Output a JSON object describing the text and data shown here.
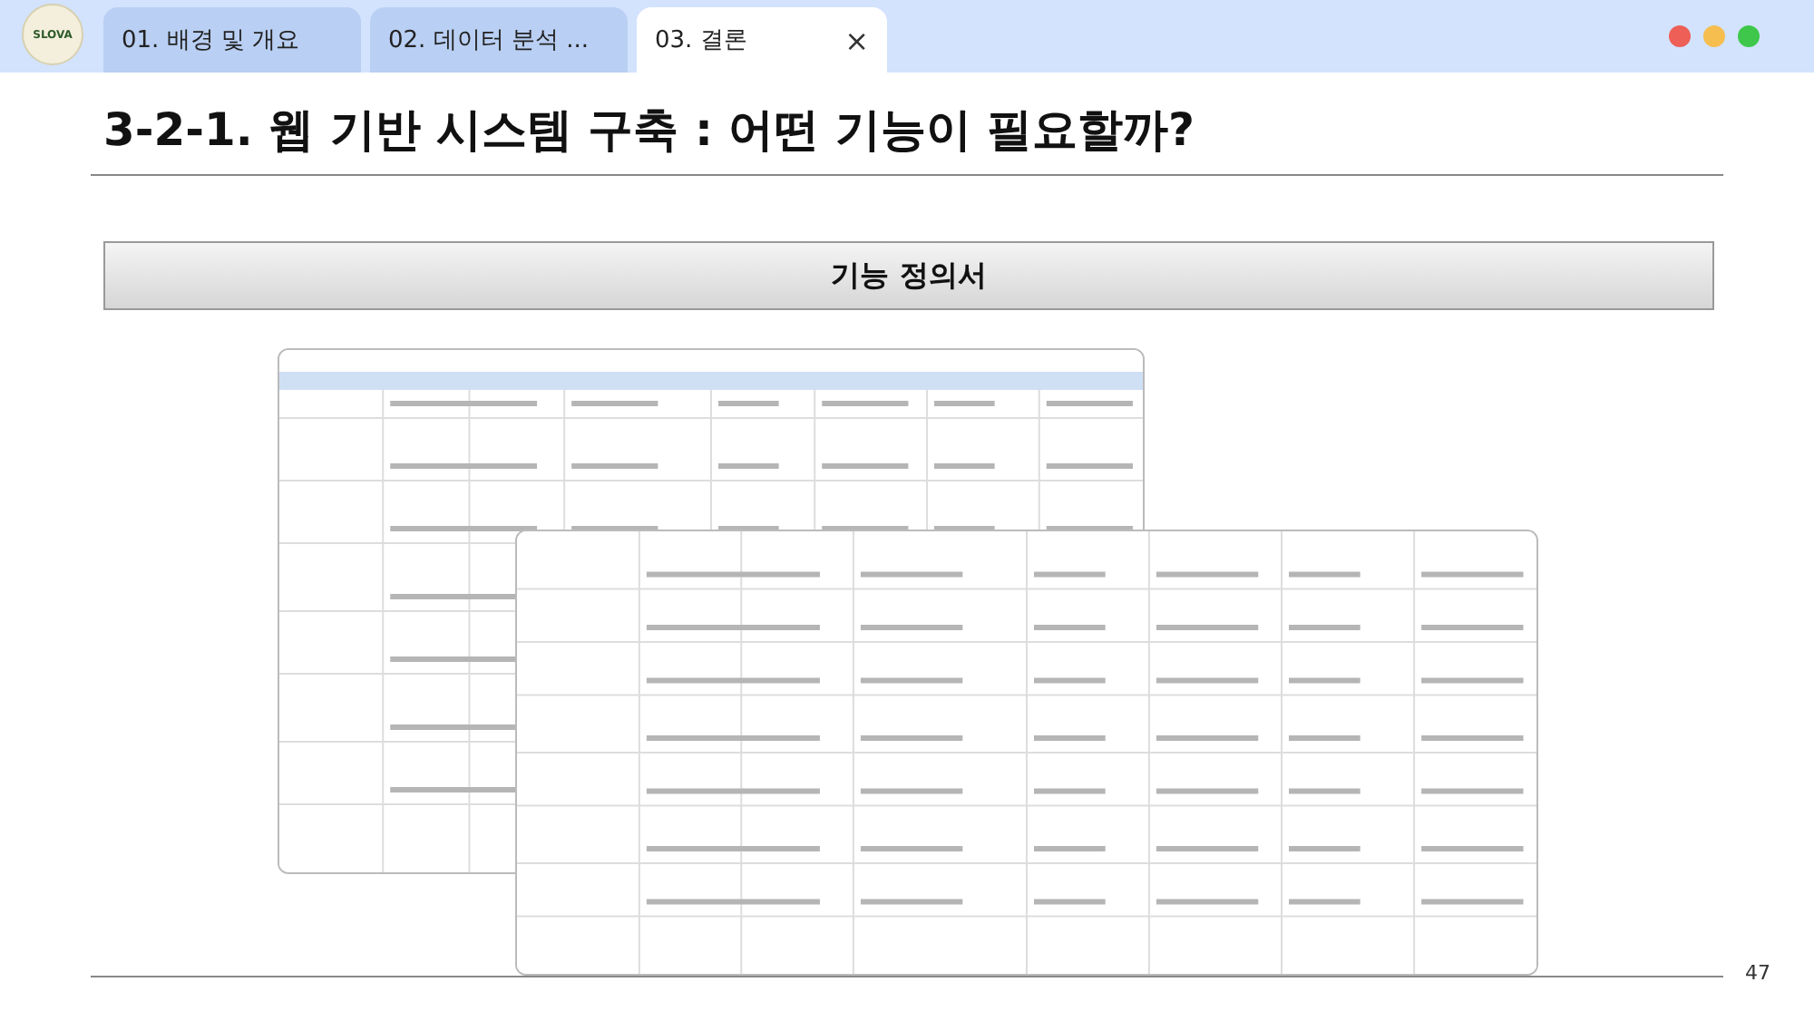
{
  "app": {
    "logo": "SLOVA"
  },
  "tabs": [
    {
      "label": "01. 배경 및 개요",
      "selected": false
    },
    {
      "label": "02. 데이터 분석 ...",
      "selected": false
    },
    {
      "label": "03. 결론",
      "selected": true,
      "close": "×"
    }
  ],
  "slide": {
    "title": "3-2-1. 웹 기반 시스템 구축 : 어떤 기능이 필요할까?",
    "banner": "기능 정의서",
    "page_number": "47"
  }
}
